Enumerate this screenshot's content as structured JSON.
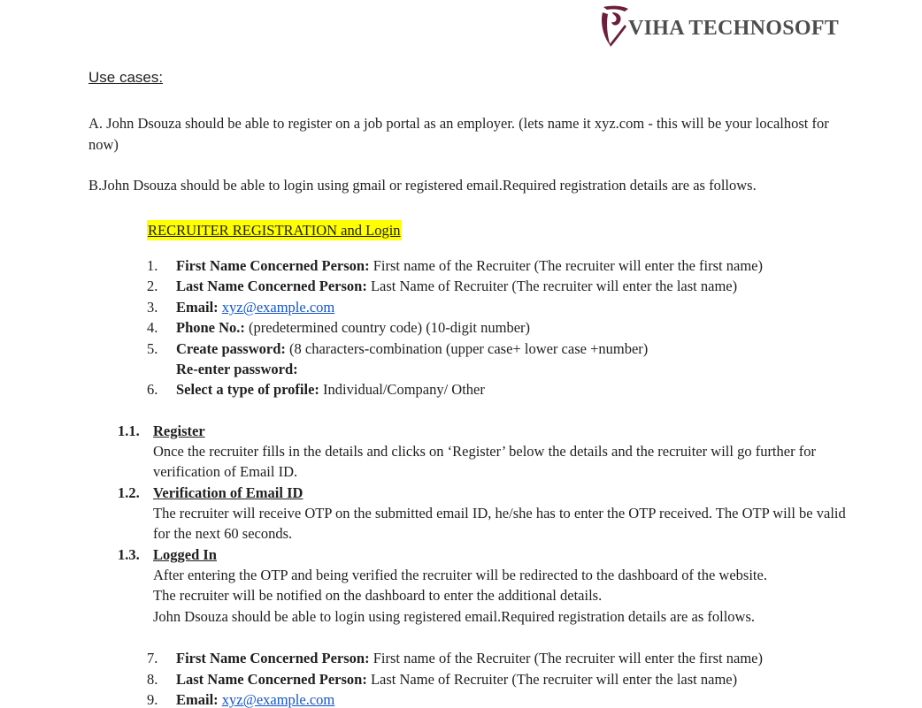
{
  "logo": {
    "text": "VIHA TECHNOSOFT",
    "colors": {
      "mark": "#6b1f3a",
      "text": "#4d4d4d"
    }
  },
  "heading": "Use cases:",
  "use_case_a": "A. John Dsouza should be able to register on a job portal as an employer.  (lets name it xyz.com  - this will be your localhost for now)",
  "use_case_b": "B.John Dsouza should be able to login using gmail or registered email.Required registration details are as follows.",
  "section_title": "RECRUITER REGISTRATION and Login",
  "highlight_color": "#ffff00",
  "fields": [
    {
      "num": "1.",
      "label": "First Name Concerned Person:",
      "desc": " First name of the Recruiter (The recruiter will enter the first name)"
    },
    {
      "num": "2.",
      "label": "Last Name Concerned Person:",
      "desc": " Last Name of Recruiter (The recruiter will enter the last name)"
    },
    {
      "num": "3.",
      "label": "Email:",
      "link": "xyz@example.com"
    },
    {
      "num": "4.",
      "label": "Phone No.:",
      "desc": " (predetermined country code) (10-digit number)"
    },
    {
      "num": "5.",
      "label": "Create password:",
      "desc": " (8 characters-combination (upper case+ lower case +number)"
    },
    {
      "num": "6.",
      "label": "Select a type of profile:",
      "desc": " Individual/Company/ Other"
    }
  ],
  "reenter_password_label": "Re-enter password:",
  "sections": [
    {
      "num": "1.1.",
      "title": "Register",
      "body": "Once the recruiter fills in the details and clicks on ‘Register’ below the details and the recruiter will go further for verification of Email ID."
    },
    {
      "num": "1.2.",
      "title": "Verification of Email ID",
      "body": "The recruiter will receive OTP on the submitted email ID, he/she has to enter the OTP received. The OTP will be valid for the next 60 seconds."
    },
    {
      "num": "1.3.",
      "title": "Logged In",
      "body_lines": [
        "After entering the OTP and being verified the recruiter will be redirected to the dashboard of the website.",
        "The recruiter will be notified on the dashboard to enter the additional details.",
        "John Dsouza should be able to login using registered email.Required registration details are as follows."
      ]
    }
  ],
  "login_fields": [
    {
      "num": "7.",
      "label": "First Name Concerned Person:",
      "desc": " First name of the Recruiter (The recruiter will enter the first name)"
    },
    {
      "num": "8.",
      "label": "Last Name Concerned Person:",
      "desc": " Last Name of Recruiter (The recruiter will enter the last name)"
    },
    {
      "num": "9.",
      "label": "Email:",
      "link": "xyz@example.com"
    }
  ]
}
